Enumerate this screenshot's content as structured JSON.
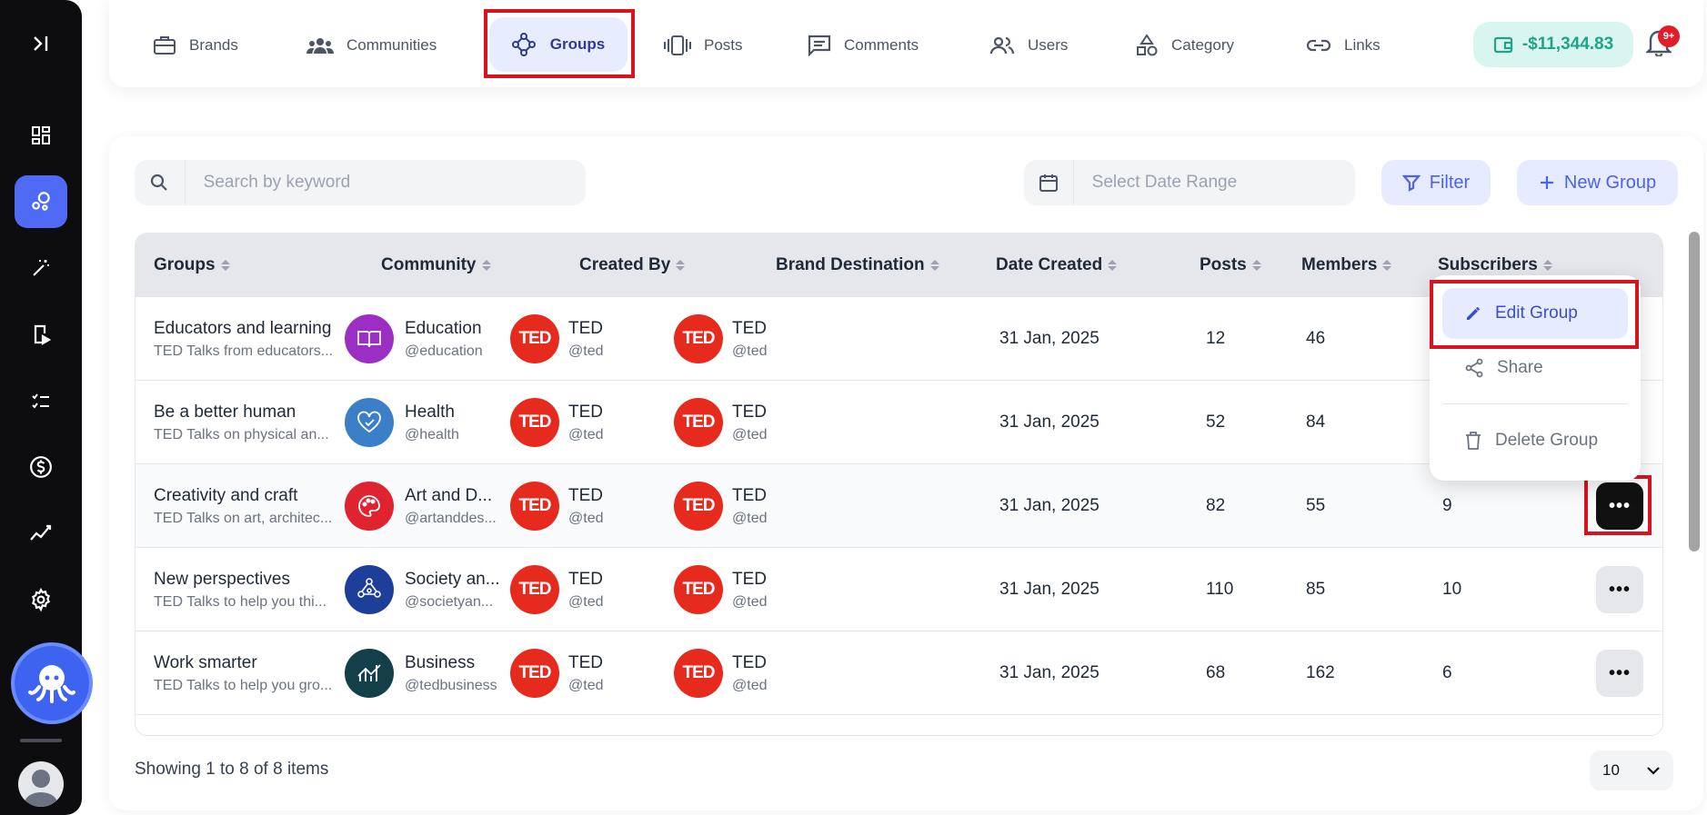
{
  "nav": {
    "items": [
      {
        "label": "Brands",
        "icon": "briefcase-icon"
      },
      {
        "label": "Communities",
        "icon": "people-group-icon"
      },
      {
        "label": "Groups",
        "icon": "groups-nodes-icon"
      },
      {
        "label": "Posts",
        "icon": "posts-carousel-icon"
      },
      {
        "label": "Comments",
        "icon": "comment-icon"
      },
      {
        "label": "Users",
        "icon": "users-icon"
      },
      {
        "label": "Category",
        "icon": "shapes-icon"
      },
      {
        "label": "Links",
        "icon": "link-icon"
      }
    ],
    "active": "Groups",
    "balance": "-$11,344.83",
    "notification_badge": "9+"
  },
  "sidebar": {
    "icons": [
      "collapse-sidebar-icon",
      "dashboard-icon",
      "groups-icon",
      "magic-wand-icon",
      "video-play-icon",
      "checklist-icon",
      "dollar-icon",
      "analytics-icon",
      "settings-icon"
    ]
  },
  "toolbar": {
    "search_placeholder": "Search by keyword",
    "date_placeholder": "Select Date Range",
    "filter_label": "Filter",
    "new_group_label": "New Group"
  },
  "table": {
    "headers": [
      "Groups",
      "Community",
      "Created By",
      "Brand Destination",
      "Date Created",
      "Posts",
      "Members",
      "Subscribers"
    ],
    "rows": [
      {
        "group": "Educators and learning",
        "group_desc": "TED Talks from educators...",
        "community": "Education",
        "community_handle": "@education",
        "community_color": "#9b2fc4",
        "community_icon": "book-icon",
        "creator": "TED",
        "creator_handle": "@ted",
        "brand": "TED",
        "brand_handle": "@ted",
        "date": "31 Jan, 2025",
        "posts": "12",
        "members": "46",
        "subscribers": ""
      },
      {
        "group": "Be a better human",
        "group_desc": "TED Talks on physical an...",
        "community": "Health",
        "community_handle": "@health",
        "community_color": "#3b7fc8",
        "community_icon": "heart-icon",
        "creator": "TED",
        "creator_handle": "@ted",
        "brand": "TED",
        "brand_handle": "@ted",
        "date": "31 Jan, 2025",
        "posts": "52",
        "members": "84",
        "subscribers": ""
      },
      {
        "group": "Creativity and craft",
        "group_desc": "TED Talks on art, architec...",
        "community": "Art and D...",
        "community_handle": "@artanddes...",
        "community_color": "#e0242f",
        "community_icon": "palette-icon",
        "creator": "TED",
        "creator_handle": "@ted",
        "brand": "TED",
        "brand_handle": "@ted",
        "date": "31 Jan, 2025",
        "posts": "82",
        "members": "55",
        "subscribers": "9"
      },
      {
        "group": "New perspectives",
        "group_desc": "TED Talks to help you thi...",
        "community": "Society an...",
        "community_handle": "@societyan...",
        "community_color": "#1d3f9a",
        "community_icon": "society-network-icon",
        "creator": "TED",
        "creator_handle": "@ted",
        "brand": "TED",
        "brand_handle": "@ted",
        "date": "31 Jan, 2025",
        "posts": "110",
        "members": "85",
        "subscribers": "10"
      },
      {
        "group": "Work smarter",
        "group_desc": "TED Talks to help you gro...",
        "community": "Business",
        "community_handle": "@tedbusiness",
        "community_color": "#123f4a",
        "community_icon": "business-chart-icon",
        "creator": "TED",
        "creator_handle": "@ted",
        "brand": "TED",
        "brand_handle": "@ted",
        "date": "31 Jan, 2025",
        "posts": "68",
        "members": "162",
        "subscribers": "6"
      }
    ]
  },
  "menu": {
    "edit": "Edit Group",
    "share": "Share",
    "delete": "Delete Group"
  },
  "footer": {
    "showing": "Showing 1 to 8 of 8 items",
    "page_size": "10"
  },
  "colors": {
    "accent": "#4f6bf5",
    "highlight_box": "#d9121f",
    "balance_text": "#21a38a",
    "ted_red": "#e62b1e"
  }
}
